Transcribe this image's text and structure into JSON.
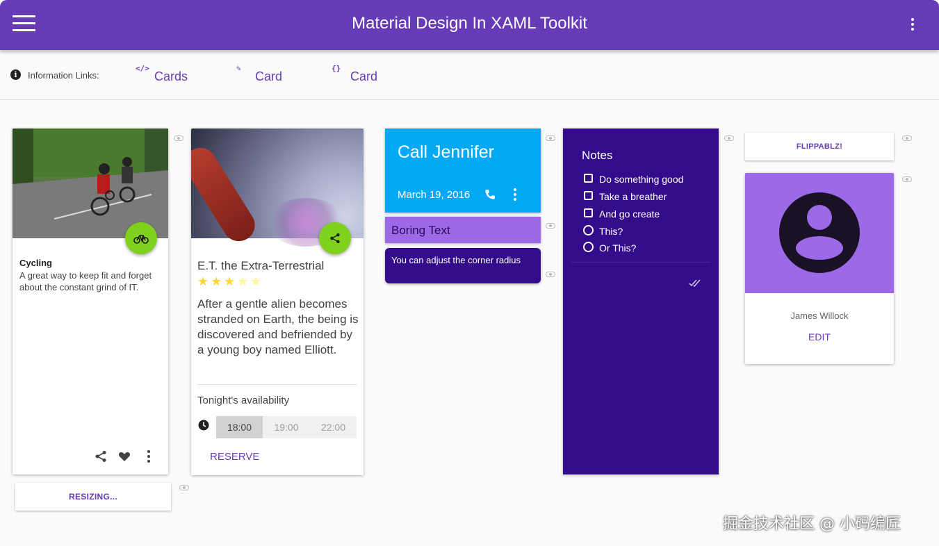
{
  "appbar": {
    "title": "Material Design In XAML Toolkit",
    "menu_icon": "hamburger-menu-icon",
    "more_icon": "more-vert-icon"
  },
  "info_links": {
    "label": "Information Links:",
    "links": [
      {
        "icon": "</>",
        "text": "Cards"
      },
      {
        "icon": "✎",
        "text": "Card"
      },
      {
        "icon": "{}",
        "text": "Card"
      }
    ]
  },
  "cycling_card": {
    "title": "Cycling",
    "description": "A great way to keep fit and forget about the constant grind of IT.",
    "fab_icon": "bike-icon",
    "actions": [
      "share-icon",
      "heart-icon",
      "more-vert-icon"
    ]
  },
  "resizing_button": {
    "label": "RESIZING..."
  },
  "movie_card": {
    "title": "E.T. the Extra-Terrestrial",
    "rating": 3,
    "max_rating": 5,
    "description": "After a gentle alien becomes stranded on Earth, the being is discovered and befriended by a young boy named Elliott.",
    "availability_label": "Tonight's availability",
    "times": [
      "18:00",
      "19:00",
      "22:00"
    ],
    "selected_time": "18:00",
    "reserve_label": "RESERVE",
    "fab_icon": "share-icon"
  },
  "call_card": {
    "title": "Call Jennifer",
    "date": "March 19, 2016"
  },
  "boring_card": {
    "text": "Boring Text"
  },
  "corner_card": {
    "text": "You can adjust the corner radius"
  },
  "notes_card": {
    "title": "Notes",
    "checks": [
      "Do something good",
      "Take a breather",
      "And go create"
    ],
    "radios": [
      "This?",
      "Or This?"
    ]
  },
  "flip_button": {
    "label": "FLIPPABLZ!"
  },
  "profile_card": {
    "name": "James Willock",
    "edit_label": "EDIT"
  },
  "watermark": "掘金技术社区 @ 小码编匠",
  "colors": {
    "primary": "#673ab7",
    "light_primary": "#9c6ae8",
    "dark_primary": "#330c8b",
    "accent": "#7fd11b",
    "light_blue": "#03a9f4",
    "star": "#fdd835"
  }
}
